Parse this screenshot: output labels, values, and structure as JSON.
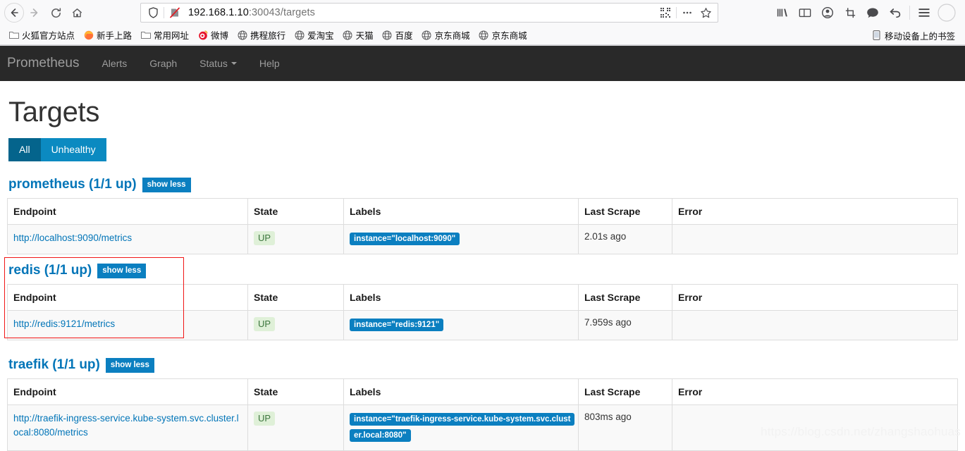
{
  "browser": {
    "nav": {
      "back_icon": "arrow-left-icon",
      "forward_icon": "arrow-right-icon",
      "reload_icon": "reload-icon",
      "home_icon": "home-icon"
    },
    "urlbar": {
      "shield_icon": "shield-icon",
      "blocked_icon": "page-blocked-icon",
      "url_host": "192.168.1.10",
      "url_rest": ":30043/targets",
      "full_url": "192.168.1.10:30043/targets",
      "qr_icon": "qr-code-icon",
      "more_icon": "ellipsis-icon",
      "bookmark_icon": "star-icon"
    },
    "toolbar_right": [
      {
        "name": "library-icon",
        "glyph": "library"
      },
      {
        "name": "sidebar-icon",
        "glyph": "sidebar"
      },
      {
        "name": "account-icon",
        "glyph": "account"
      },
      {
        "name": "screenshot-icon",
        "glyph": "crop"
      },
      {
        "name": "pocket-icon",
        "glyph": "chat"
      },
      {
        "name": "undo-icon",
        "glyph": "undo"
      },
      {
        "name": "menu-icon",
        "glyph": "hamburger"
      }
    ],
    "bookmarks": [
      {
        "label": "火狐官方站点",
        "icon": "folder-icon"
      },
      {
        "label": "新手上路",
        "icon": "firefox-icon"
      },
      {
        "label": "常用网址",
        "icon": "folder-icon"
      },
      {
        "label": "微博",
        "icon": "weibo-icon"
      },
      {
        "label": "携程旅行",
        "icon": "globe-icon"
      },
      {
        "label": "爱淘宝",
        "icon": "globe-icon"
      },
      {
        "label": "天猫",
        "icon": "globe-icon"
      },
      {
        "label": "百度",
        "icon": "globe-icon"
      },
      {
        "label": "京东商城",
        "icon": "globe-icon"
      },
      {
        "label": "京东商城",
        "icon": "globe-icon"
      }
    ],
    "bookmarks_right": {
      "label": "移动设备上的书签",
      "icon": "mobile-device-icon"
    }
  },
  "promnav": {
    "brand": "Prometheus",
    "links": [
      {
        "label": "Alerts",
        "has_caret": false
      },
      {
        "label": "Graph",
        "has_caret": false
      },
      {
        "label": "Status",
        "has_caret": true
      },
      {
        "label": "Help",
        "has_caret": false
      }
    ]
  },
  "page": {
    "title": "Targets",
    "filters": [
      {
        "label": "All",
        "active": true
      },
      {
        "label": "Unhealthy",
        "active": false
      }
    ],
    "columns": [
      "Endpoint",
      "State",
      "Labels",
      "Last Scrape",
      "Error"
    ],
    "jobs": [
      {
        "title": "prometheus (1/1 up)",
        "toggle_label": "show less",
        "highlighted": false,
        "rows": [
          {
            "endpoint": "http://localhost:9090/metrics",
            "state": "UP",
            "labels": [
              "instance=\"localhost:9090\""
            ],
            "last_scrape": "2.01s ago",
            "error": ""
          }
        ]
      },
      {
        "title": "redis (1/1 up)",
        "toggle_label": "show less",
        "highlighted": true,
        "rows": [
          {
            "endpoint": "http://redis:9121/metrics",
            "state": "UP",
            "labels": [
              "instance=\"redis:9121\""
            ],
            "last_scrape": "7.959s ago",
            "error": ""
          }
        ]
      },
      {
        "title": "traefik (1/1 up)",
        "toggle_label": "show less",
        "highlighted": false,
        "rows": [
          {
            "endpoint": "http://traefik-ingress-service.kube-system.svc.cluster.local:8080/metrics",
            "state": "UP",
            "labels": [
              "instance=\"traefik-ingress-service.kube-system.svc.cluster.local:8080\""
            ],
            "last_scrape": "803ms ago",
            "error": ""
          }
        ]
      }
    ]
  },
  "watermark": "https://blog.csdn.net/zhangshaohuas",
  "colors": {
    "navbar_bg": "#292929",
    "link_blue": "#0275b8",
    "badge_blue": "#0b7fc0",
    "filter_active": "#04648c",
    "filter_inactive": "#0b8ac1",
    "state_up_bg": "#dff0d8",
    "state_up_text": "#3c763d",
    "highlight_red": "#f01616"
  }
}
